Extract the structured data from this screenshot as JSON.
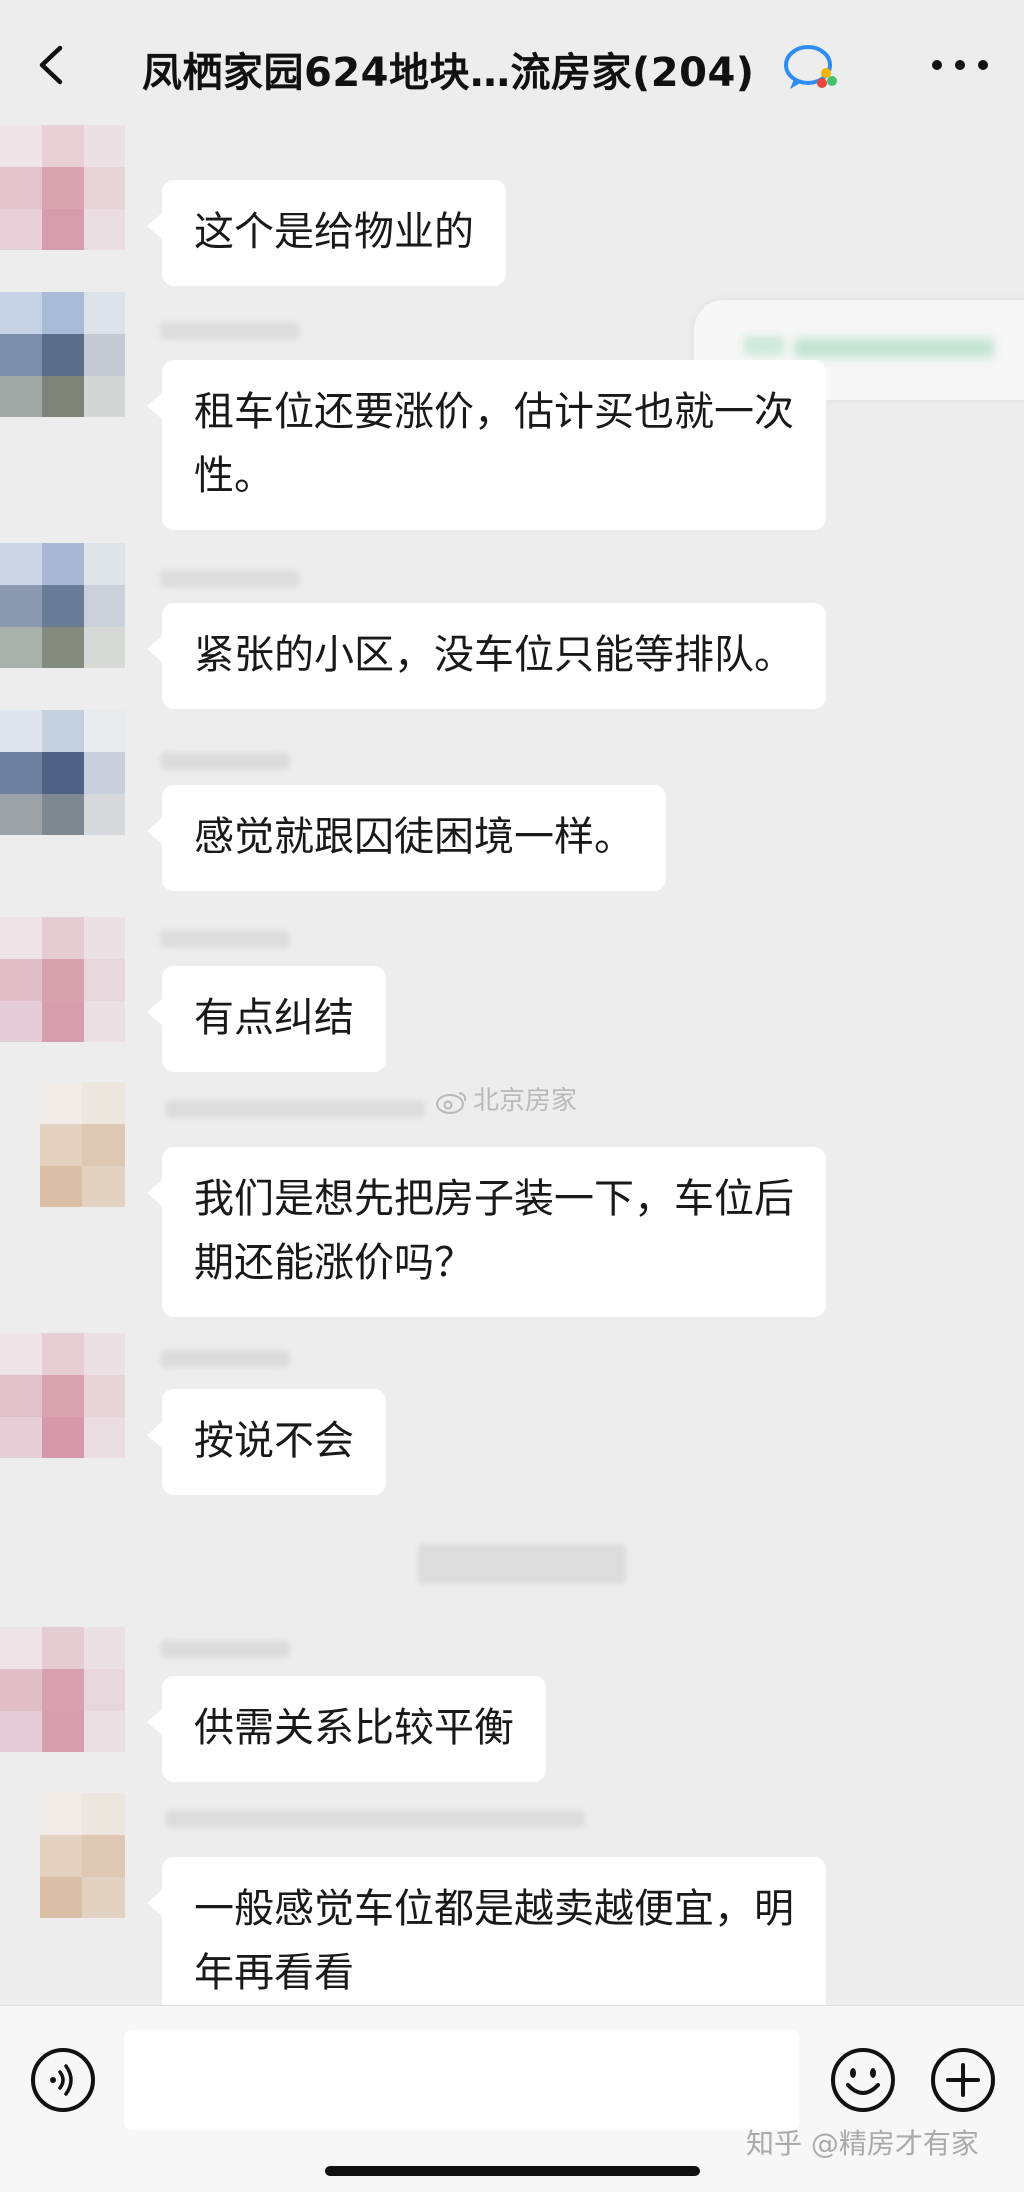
{
  "header": {
    "title": "凤栖家园624地块…流房家(204)"
  },
  "messages": [
    {
      "text_lines": [
        "这个是给物业的"
      ]
    },
    {
      "text_lines": [
        "租车位还要涨价，估计买也就一次",
        "性。"
      ]
    },
    {
      "text_lines": [
        "紧张的小区，没车位只能等排队。"
      ]
    },
    {
      "text_lines": [
        "感觉就跟囚徒困境一样。"
      ]
    },
    {
      "text_lines": [
        "有点纠结"
      ]
    },
    {
      "text_lines": [
        "我们是想先把房子装一下，车位后",
        "期还能涨价吗？"
      ]
    },
    {
      "text_lines": [
        "按说不会"
      ]
    },
    {
      "text_lines": [
        "供需关系比较平衡"
      ]
    },
    {
      "text_lines": [
        "一般感觉车位都是越卖越便宜，明",
        "年再看看"
      ]
    }
  ],
  "watermark": {
    "text": "北京房家"
  },
  "footer": {
    "credit": "知乎 @精房才有家"
  },
  "icons": [
    "back-arrow-icon",
    "wecom-chat-icon",
    "more-icon",
    "voice-icon",
    "emoji-icon",
    "plus-icon",
    "weibo-icon"
  ],
  "colors": {
    "background": "#ededed",
    "bubble": "#ffffff",
    "text": "#191919"
  }
}
